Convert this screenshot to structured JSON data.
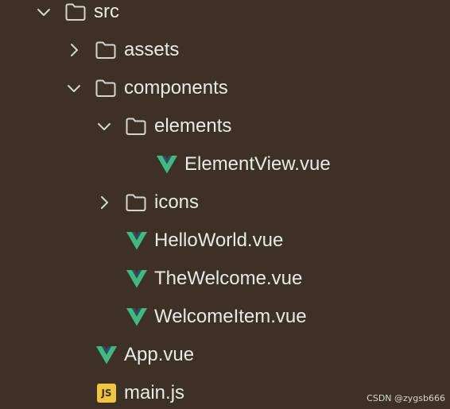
{
  "tree": {
    "src": {
      "label": "src"
    },
    "assets": {
      "label": "assets"
    },
    "components": {
      "label": "components"
    },
    "elements": {
      "label": "elements"
    },
    "element_view": {
      "label": "ElementView.vue"
    },
    "icons": {
      "label": "icons"
    },
    "hello_world": {
      "label": "HelloWorld.vue"
    },
    "the_welcome": {
      "label": "TheWelcome.vue"
    },
    "welcome_item": {
      "label": "WelcomeItem.vue"
    },
    "app": {
      "label": "App.vue"
    },
    "main": {
      "label": "main.js",
      "badge": "JS"
    }
  },
  "icons": {
    "folder": "folder-icon",
    "vue": "vue-file-icon",
    "js": "js-file-icon",
    "chevron_down": "chevron-down-icon",
    "chevron_right": "chevron-right-icon"
  },
  "colors": {
    "background": "#3d3126",
    "text": "#ebe9e6",
    "vue_green": "#41b883",
    "vue_dark": "#34495e",
    "js_yellow": "#f0c542"
  },
  "watermark": "CSDN @zygsb666"
}
